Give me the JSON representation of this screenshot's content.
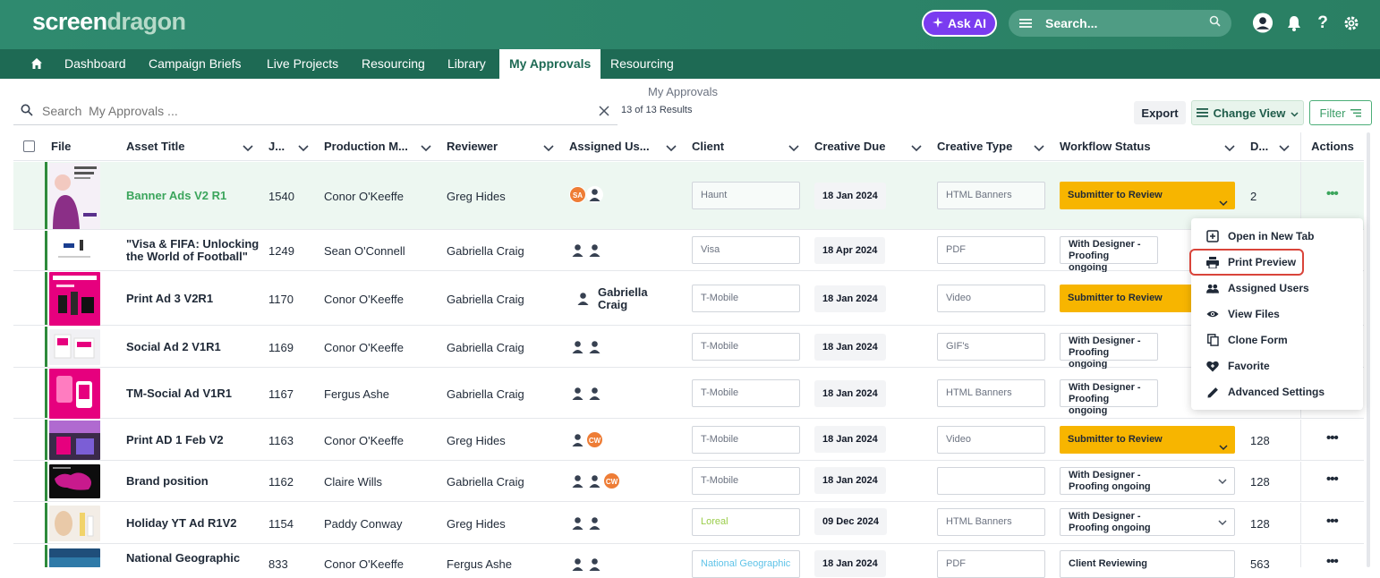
{
  "app": {
    "logo_part1": "screen",
    "logo_part2": "dragon"
  },
  "topbar": {
    "ask_ai": "Ask AI",
    "search_placeholder": "Search..."
  },
  "nav": {
    "items": [
      "Dashboard",
      "Campaign Briefs",
      "Live Projects",
      "Resourcing",
      "Library",
      "My Approvals",
      "Resourcing"
    ],
    "active": "My Approvals"
  },
  "page": {
    "title": "My Approvals",
    "search_placeholder": "Search  My Approvals ...",
    "results": "13 of 13 Results"
  },
  "toolbar": {
    "export": "Export",
    "change_view": "Change View",
    "filter": "Filter"
  },
  "table": {
    "columns": [
      "File",
      "Asset Title",
      "J...",
      "Production M...",
      "Reviewer",
      "Assigned Us...",
      "Client",
      "Creative Due",
      "Creative Type",
      "Workflow Status",
      "D...",
      "Actions"
    ],
    "rows": [
      {
        "title": "Banner Ads V2 R1",
        "job": "1540",
        "production": "Conor O'Keeffe",
        "reviewer": "Greg Hides",
        "client": "Haunt",
        "due": "18 Jan 2024",
        "type": "HTML Banners",
        "status": "Submitter to Review",
        "d": "2"
      },
      {
        "title": "\"Visa & FIFA: Unlocking the World of Football\"",
        "job": "1249",
        "production": "Sean O'Connell",
        "reviewer": "Gabriella Craig",
        "client": "Visa",
        "due": "18 Apr 2024",
        "type": "PDF",
        "status": "With Designer - Proofing ongoing",
        "d": ""
      },
      {
        "title": "Print Ad 3 V2R1",
        "job": "1170",
        "production": "Conor O'Keeffe",
        "reviewer": "Gabriella Craig",
        "assigned_name": "Gabriella Craig",
        "client": "T-Mobile",
        "due": "18 Jan 2024",
        "type": "Video",
        "status": "Submitter to Review",
        "d": ""
      },
      {
        "title": "Social Ad 2 V1R1",
        "job": "1169",
        "production": "Conor O'Keeffe",
        "reviewer": "Gabriella Craig",
        "client": "T-Mobile",
        "due": "18 Jan 2024",
        "type": "GIF's",
        "status": "With Designer - Proofing ongoing",
        "d": ""
      },
      {
        "title": "TM-Social Ad V1R1",
        "job": "1167",
        "production": "Fergus Ashe",
        "reviewer": "Gabriella Craig",
        "client": "T-Mobile",
        "due": "18 Jan 2024",
        "type": "HTML Banners",
        "status": "With Designer - Proofing ongoing",
        "d": ""
      },
      {
        "title": "Print AD 1 Feb V2",
        "job": "1163",
        "production": "Conor O'Keeffe",
        "reviewer": "Greg Hides",
        "client": "T-Mobile",
        "due": "18 Jan 2024",
        "type": "Video",
        "status": "Submitter to Review",
        "d": "128"
      },
      {
        "title": "Brand position",
        "job": "1162",
        "production": "Claire Wills",
        "reviewer": "Gabriella Craig",
        "client": "T-Mobile",
        "due": "18 Jan 2024",
        "type": "",
        "status": "With Designer - Proofing ongoing",
        "d": "128"
      },
      {
        "title": "Holiday YT Ad R1V2",
        "job": "1154",
        "production": "Paddy Conway",
        "reviewer": "Greg Hides",
        "client": "Loreal",
        "due": "09 Dec 2024",
        "type": "HTML Banners",
        "status": "With Designer - Proofing ongoing",
        "d": "128"
      },
      {
        "title": "National Geographic",
        "job": "833",
        "production": "Conor O'Keeffe",
        "reviewer": "Fergus Ashe",
        "client": "National Geographic",
        "due": "18 Jan 2024",
        "type": "PDF",
        "status": "Client Reviewing",
        "d": "563"
      }
    ],
    "avatar_initials": {
      "sa": "SA",
      "cw": "CW"
    }
  },
  "context_menu": {
    "items": [
      "Open in New Tab",
      "Print Preview",
      "Assigned Users",
      "View Files",
      "Clone Form",
      "Favorite",
      "Advanced Settings"
    ],
    "highlighted": "Print Preview"
  },
  "colors": {
    "brand": "#2c8469",
    "nav": "#1e6a54",
    "accent_green": "#3ba55c",
    "status_yellow": "#f7b500",
    "ask_ai": "#7a3cf0",
    "highlight": "#d9443a"
  }
}
